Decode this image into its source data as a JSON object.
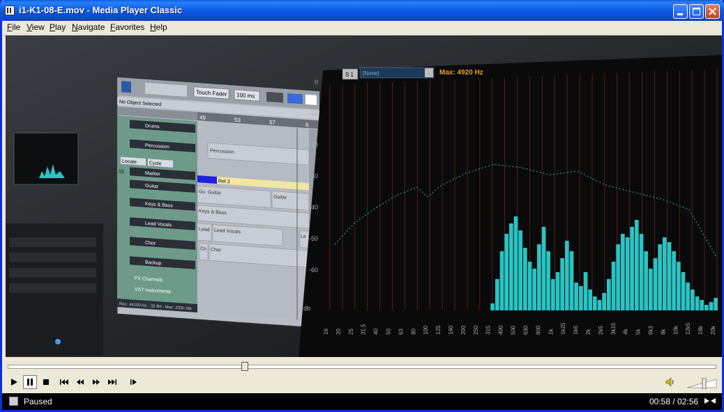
{
  "window": {
    "title": "i1-K1-08-E.mov - Media Player Classic"
  },
  "menu": [
    "File",
    "View",
    "Play",
    "Navigate",
    "Favorites",
    "Help"
  ],
  "video": {
    "daw": {
      "transport": {
        "mode": "Touch Fader",
        "time": "100 ms"
      },
      "status": "No Object Selected",
      "ruler": [
        "49",
        "53",
        "57",
        "6"
      ],
      "tracks": [
        {
          "name": "Drums",
          "num": ""
        },
        {
          "name": "Percussion",
          "num": ""
        },
        {
          "name": "Marker",
          "num": "15"
        },
        {
          "name": "Guitar",
          "num": ""
        },
        {
          "name": "Keys & Bass",
          "num": ""
        },
        {
          "name": "Lead Vocals",
          "num": ""
        },
        {
          "name": "Chor",
          "num": ""
        },
        {
          "name": "Backup",
          "num": ""
        },
        {
          "name": "FX Channels",
          "num": ""
        },
        {
          "name": "VST-Instrumente",
          "num": ""
        }
      ],
      "locate": "Locate",
      "cycle": "Cycle",
      "regions": {
        "percussion": "Percussion",
        "marker": "Ref 2",
        "guitar1": "Guitar",
        "guitar2": "Guitar",
        "guitar_short": "Gu",
        "keys": "Keys & Bass",
        "lead1": "Lead",
        "lead2": "Lead Vocals",
        "lead3": "Le",
        "chor1": "Ch",
        "chor2": "Chor"
      },
      "footer": "Rec: 44100 Hz - 32 Bit - Max: 233h 09r"
    },
    "analyzer": {
      "slot": "S 1",
      "preset": "[None]",
      "max_label": "Max: 4920 Hz",
      "db_labels": [
        "0",
        "-10",
        "-20",
        "-30",
        "-40",
        "-50",
        "-60",
        "db"
      ],
      "freq_labels": [
        "16",
        "20",
        "25",
        "31.5",
        "40",
        "50",
        "63",
        "80",
        "100",
        "125",
        "160",
        "200",
        "250",
        "315",
        "400",
        "500",
        "630",
        "800",
        "1k",
        "1k25",
        "1k6",
        "2k",
        "2k5",
        "3k15",
        "4k",
        "5k",
        "6k3",
        "8k",
        "10k",
        "12k5",
        "16k",
        "20k"
      ]
    }
  },
  "controls": {
    "seek_position": 0.335,
    "volume_level": 0.55,
    "buttons": [
      "play-icon",
      "pause-icon",
      "stop-icon",
      "skip-back-icon",
      "rewind-icon",
      "fast-forward-icon",
      "skip-forward-icon",
      "frame-step-icon"
    ]
  },
  "status": {
    "state": "Paused",
    "time": "00:58 / 02:56"
  },
  "colors": {
    "title_bar": "#0a5fe0",
    "spectrum_bar": "#2ac4c4",
    "max_label": "#e8a030"
  }
}
